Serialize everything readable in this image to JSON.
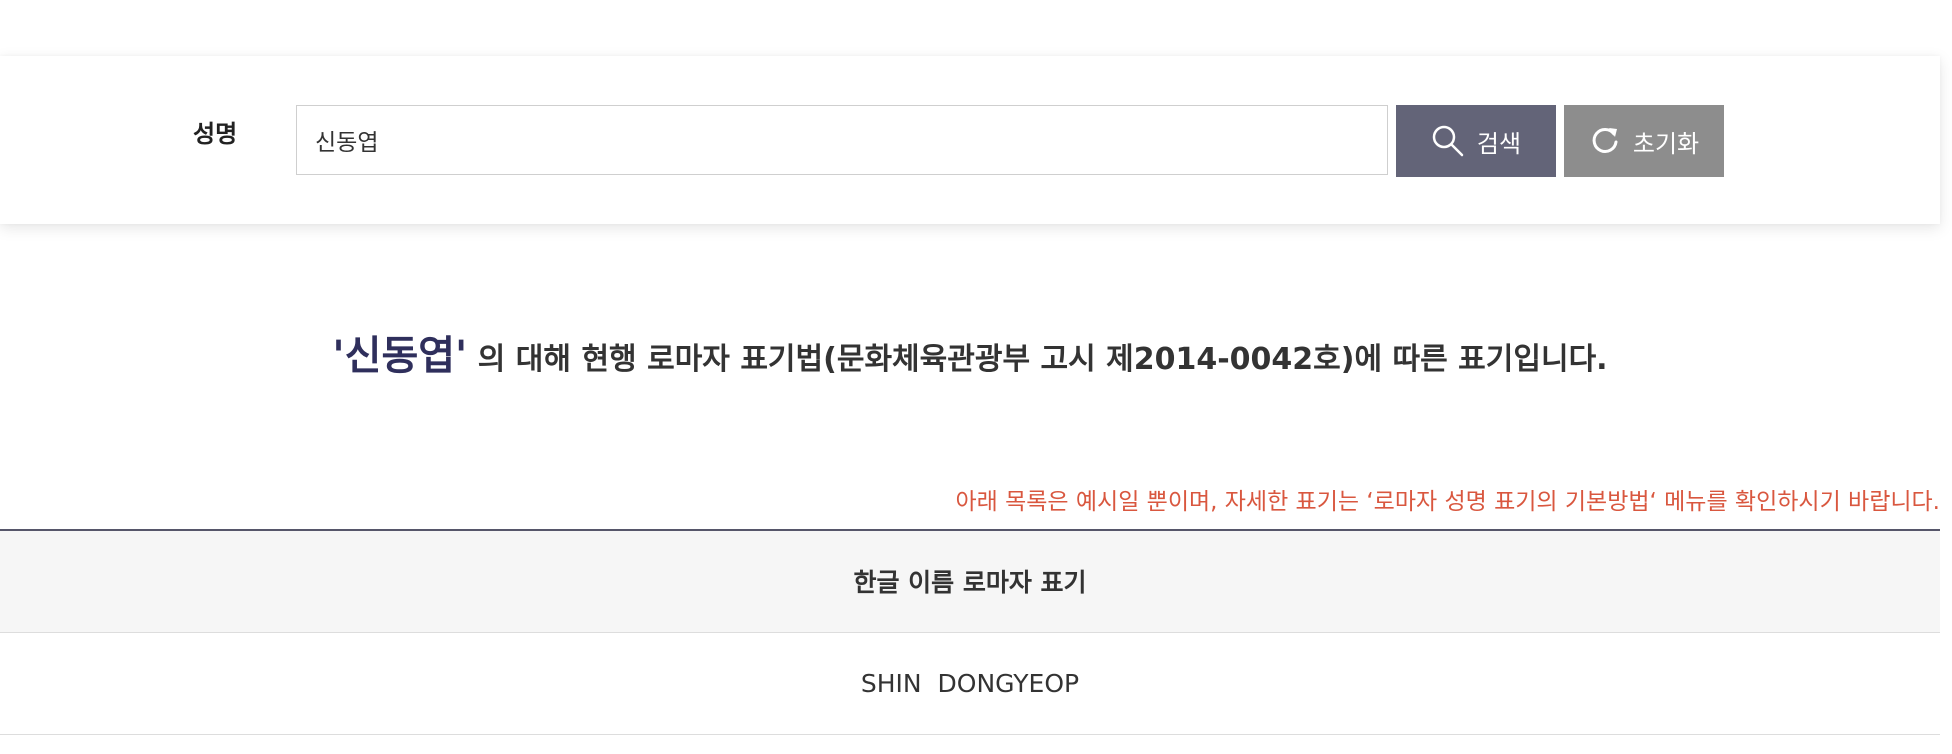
{
  "search": {
    "label": "성명",
    "value": "신동엽",
    "search_button": "검색",
    "reset_button": "초기화",
    "search_icon": "search-icon",
    "reset_icon": "refresh-icon"
  },
  "result": {
    "name_quoted": "'신동엽'",
    "description": " 의 대해 현행 로마자 표기법(문화체육관광부 고시 제2014-0042호)에 따른 표기입니다."
  },
  "notice": "아래 목록은 예시일 뿐이며, 자세한 표기는 ‘로마자 성명 표기의 기본방법‘ 메뉴를 확인하시기 바랍니다.",
  "table": {
    "header": "한글 이름 로마자 표기",
    "rows": [
      {
        "romanized": "SHIN  DONGYEOP"
      }
    ]
  },
  "colors": {
    "search_button": "#636478",
    "reset_button": "#8d8d8d",
    "name_highlight": "#2f2f5c",
    "notice": "#d9573f",
    "table_border": "#56566a"
  }
}
